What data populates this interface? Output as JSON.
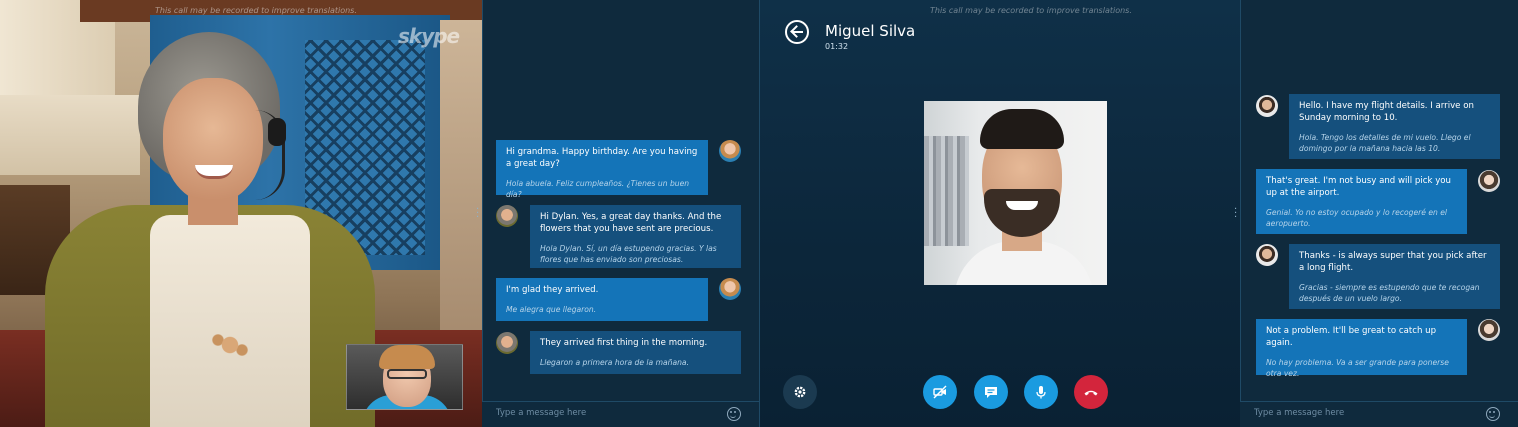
{
  "recording_notice": "This call may be recorded to improve translations.",
  "watermark": "skype",
  "left_chat": {
    "messages": [
      {
        "direction": "out",
        "en": "Hi grandma. Happy birthday. Are you having a great day?",
        "es": "Hola abuela. Feliz cumpleaños. ¿Tienes un buen día?"
      },
      {
        "direction": "in",
        "en": "Hi Dylan. Yes, a great day thanks. And the flowers that you have sent are precious.",
        "es": "Hola Dylan. Sí, un día estupendo gracias. Y las flores que has enviado son preciosas."
      },
      {
        "direction": "out",
        "en": "I'm glad they arrived.",
        "es": "Me alegra que llegaron."
      },
      {
        "direction": "in",
        "en": "They arrived first thing in the morning.",
        "es": "Llegaron a primera hora de la mañana."
      }
    ],
    "composer_placeholder": "Type a message here"
  },
  "call": {
    "caller_name": "Miguel Silva",
    "timer": "01:32"
  },
  "right_chat": {
    "messages": [
      {
        "direction": "in",
        "en": "Hello. I have my flight details. I arrive on Sunday morning to 10.",
        "es": "Hola. Tengo los detalles de mi vuelo. Llego el domingo por la mañana hacia las 10."
      },
      {
        "direction": "out",
        "en": "That's great. I'm not busy and will pick you up at the airport.",
        "es": "Genial. Yo no estoy ocupado y lo recogeré en el aeropuerto."
      },
      {
        "direction": "in",
        "en": "Thanks - is always super that you pick after a long flight.",
        "es": "Gracias - siempre es estupendo que te recogan después de un vuelo largo."
      },
      {
        "direction": "out",
        "en": "Not a problem. It'll be great to catch up again.",
        "es": "No hay problema. Va a ser grande para ponerse otra vez."
      }
    ],
    "composer_placeholder": "Type a message here"
  },
  "icons": {
    "back": "arrow-left-icon",
    "settings": "gear-icon",
    "video": "video-off-icon",
    "chat": "chat-bubble-icon",
    "mic": "microphone-icon",
    "end_call": "phone-hangup-icon",
    "emoji": "smiley-icon"
  },
  "colors": {
    "accent": "#1a9be0",
    "bubble_out": "#1474b8",
    "bubble_in": "#15507d",
    "end_call": "#d3253c",
    "panel_bg": "#0f2a3d"
  }
}
